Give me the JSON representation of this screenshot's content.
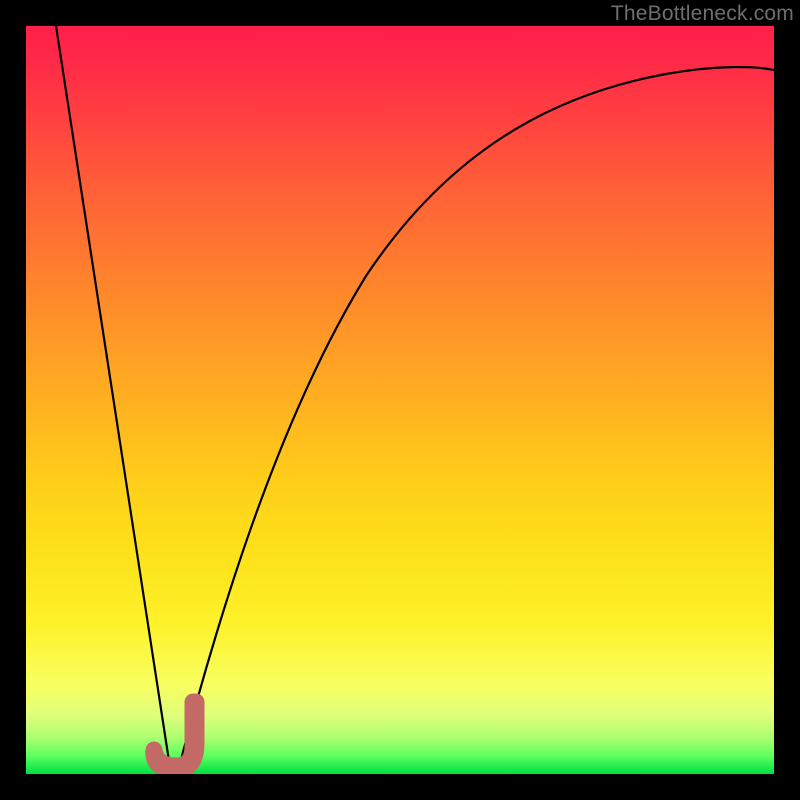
{
  "watermark": "TheBottleneck.com",
  "chart_data": {
    "type": "line",
    "title": "",
    "xlabel": "",
    "ylabel": "",
    "xlim": [
      0,
      100
    ],
    "ylim": [
      0,
      100
    ],
    "grid": false,
    "legend": false,
    "series": [
      {
        "name": "bottleneck-curve",
        "color": "#000000",
        "x": [
          4,
          6,
          8,
          10,
          12,
          14,
          16,
          17,
          18,
          19,
          20,
          22,
          24,
          26,
          28,
          30,
          34,
          38,
          42,
          46,
          50,
          55,
          60,
          65,
          70,
          75,
          80,
          85,
          90,
          95,
          100
        ],
        "y": [
          100,
          89,
          78,
          67,
          56,
          45,
          34,
          23,
          12,
          4,
          0,
          12,
          27,
          39,
          49,
          57,
          67,
          74,
          79,
          82.5,
          85,
          87.2,
          88.8,
          90,
          91,
          91.8,
          92.4,
          92.9,
          93.3,
          93.7,
          94
        ]
      },
      {
        "name": "marker-j",
        "color": "#c46a66",
        "type": "area",
        "x": [
          16.5,
          17.5,
          18.5,
          19.5,
          20.5,
          21.5,
          22.5
        ],
        "y": [
          2.5,
          1.0,
          0.5,
          0.5,
          2.0,
          5.0,
          10.0
        ]
      }
    ],
    "gradient_stops": [
      {
        "pos": 0.0,
        "color": "#ff1f4a"
      },
      {
        "pos": 0.5,
        "color": "#ffcc1a"
      },
      {
        "pos": 0.88,
        "color": "#f8ff60"
      },
      {
        "pos": 1.0,
        "color": "#00e040"
      }
    ]
  }
}
